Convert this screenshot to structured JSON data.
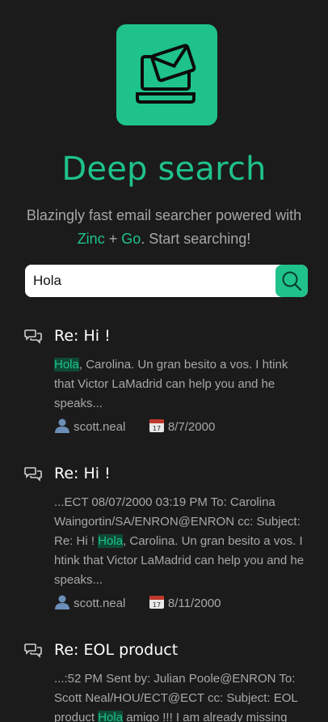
{
  "app": {
    "title": "Deep search",
    "tagline_pre": "Blazingly fast email searcher powered with ",
    "tagline_zinc": "Zinc",
    "tagline_plus": " + ",
    "tagline_go": "Go",
    "tagline_post": ". Start searching!"
  },
  "colors": {
    "accent": "#1fc28b",
    "background": "#1b1b1b"
  },
  "search": {
    "value": "Hola",
    "icon": "search-icon"
  },
  "results": [
    {
      "title": "Re: Hi !",
      "snippet_pre": "",
      "highlight": "Hola",
      "snippet_post": ", Carolina. Un gran besito a vos. I htink that Victor LaMadrid can help you and he speaks...",
      "user": "scott.neal",
      "date": "8/7/2000"
    },
    {
      "title": "Re: Hi !",
      "snippet_pre": "...ECT 08/07/2000 03:19 PM To: Carolina Waingortin/SA/ENRON@ENRON cc: Subject: Re: Hi ! ",
      "highlight": "Hola",
      "snippet_post": ", Carolina. Un gran besito a vos. I htink that Victor LaMadrid can help you and he speaks...",
      "user": "scott.neal",
      "date": "8/11/2000"
    },
    {
      "title": "Re: EOL product",
      "snippet_pre": "...:52 PM Sent by: Julian Poole@ENRON To: Scott Neal/HOU/ECT@ECT cc: Subject: EOL product ",
      "highlight": "Hola",
      "snippet_post": " amigo !!! I am already missing",
      "user": "",
      "date": ""
    }
  ]
}
